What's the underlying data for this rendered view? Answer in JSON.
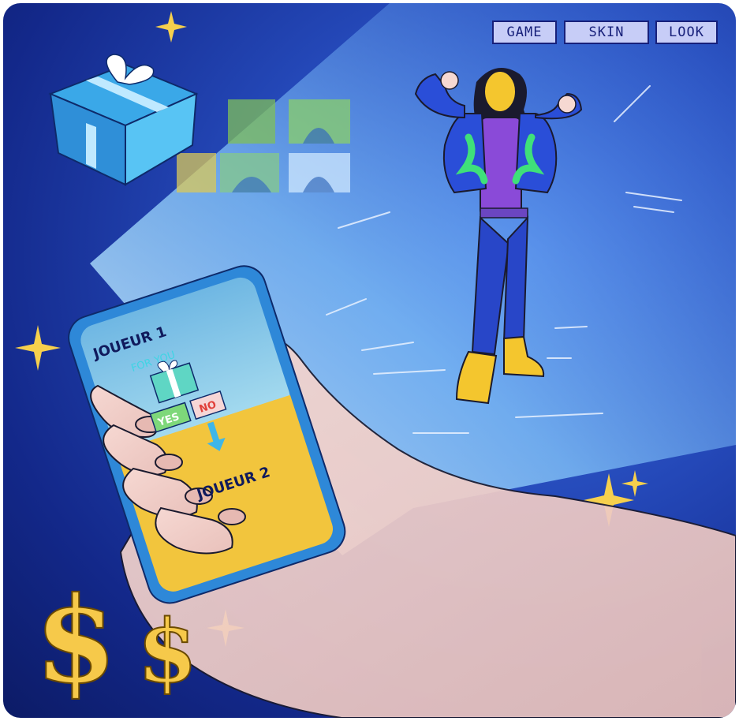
{
  "menu": {
    "game_label": "GAME",
    "skin_label": "SKIN",
    "look_label": "LOOK"
  },
  "phone": {
    "player1_label": "JOUEUR 1",
    "offer_label": "FOR YOU",
    "yes_label": "YES",
    "no_label": "NO",
    "player2_label": "JOUEUR 2"
  },
  "icons": [
    "sparkle-icon",
    "gift-icon",
    "dollar-icon",
    "arrow-down-icon"
  ],
  "colors": {
    "background": "#1a3596",
    "light_beam": "#bfe6ff",
    "phone_top": "#7cc4e8",
    "phone_bottom": "#f2c53d",
    "gold": "#f6d04d",
    "jacket": "#2a4ed8",
    "jacket_flame": "#3fe07a",
    "menu_button": "#c7cdf7"
  }
}
